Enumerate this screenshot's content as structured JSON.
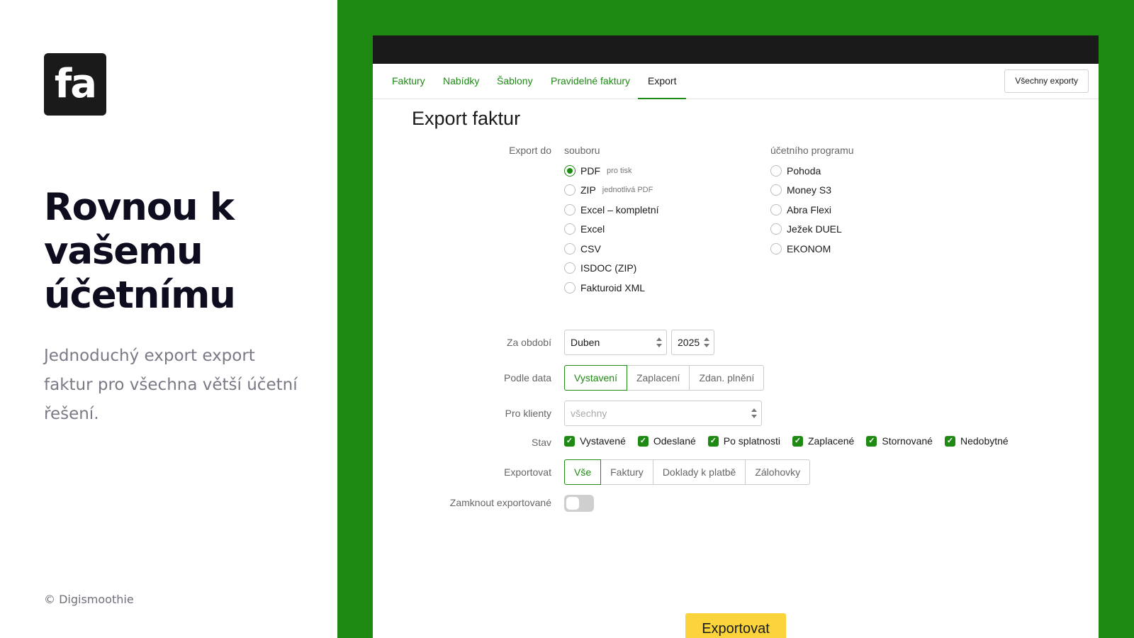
{
  "brand": {
    "logo_text": "fa",
    "headline": [
      "Rovnou k",
      "vašemu",
      "účetnímu"
    ],
    "subline": "Jednoduchý export export faktur pro všechna větší účetní řešení.",
    "copyright": "© Digismoothie"
  },
  "colors": {
    "accent": "#1e8a14",
    "button": "#fbd43b",
    "dark": "#1a1a1a"
  },
  "nav": {
    "tabs": [
      {
        "label": "Faktury"
      },
      {
        "label": "Nabídky"
      },
      {
        "label": "Šablony"
      },
      {
        "label": "Pravidelné faktury"
      },
      {
        "label": "Export",
        "active": true
      }
    ],
    "all_exports_label": "Všechny exporty"
  },
  "form": {
    "title": "Export faktur",
    "export_to_label": "Export do",
    "file_heading": "souboru",
    "program_heading": "účetního programu",
    "file_options": [
      {
        "label": "PDF",
        "hint": "pro tisk",
        "selected": true
      },
      {
        "label": "ZIP",
        "hint": "jednotlivá PDF"
      },
      {
        "label": "Excel – kompletní"
      },
      {
        "label": "Excel"
      },
      {
        "label": "CSV"
      },
      {
        "label": "ISDOC (ZIP)"
      },
      {
        "label": "Fakturoid XML"
      }
    ],
    "program_options": [
      {
        "label": "Pohoda"
      },
      {
        "label": "Money S3"
      },
      {
        "label": "Abra Flexi"
      },
      {
        "label": "Ježek DUEL"
      },
      {
        "label": "EKONOM"
      }
    ],
    "period_label": "Za období",
    "period_month": "Duben",
    "period_year": "2025",
    "date_label": "Podle data",
    "date_options": [
      {
        "label": "Vystavení",
        "selected": true
      },
      {
        "label": "Zaplacení"
      },
      {
        "label": "Zdan. plnění"
      }
    ],
    "clients_label": "Pro klienty",
    "clients_placeholder": "všechny",
    "status_label": "Stav",
    "statuses": [
      "Vystavené",
      "Odeslané",
      "Po splatnosti",
      "Zaplacené",
      "Stornované",
      "Nedobytné"
    ],
    "export_label": "Exportovat",
    "export_options": [
      {
        "label": "Vše",
        "selected": true
      },
      {
        "label": "Faktury"
      },
      {
        "label": "Doklady k platbě"
      },
      {
        "label": "Zálohovky"
      }
    ],
    "lock_label": "Zamknout exportované",
    "lock_enabled": false,
    "submit_label": "Exportovat"
  }
}
